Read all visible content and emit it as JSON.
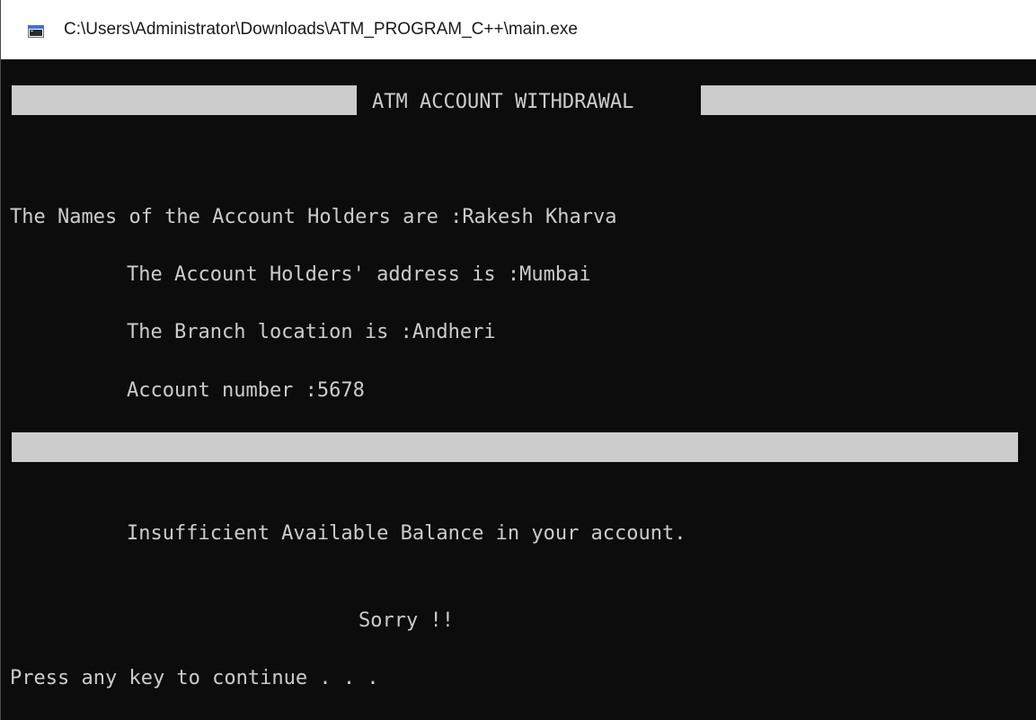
{
  "window": {
    "title": "C:\\Users\\Administrator\\Downloads\\ATM_PROGRAM_C++\\main.exe",
    "icon": "console-window-icon"
  },
  "console": {
    "header": "ATM ACCOUNT WITHDRAWAL",
    "account_holders": "The Names of the Account Holders are :Rakesh Kharva",
    "address": "The Account Holders' address is :Mumbai",
    "branch": "The Branch location is :Andheri",
    "account_number": "Account number :5678",
    "message": "Insufficient Available Balance in your account.",
    "sorry": "Sorry !!",
    "prompt": "Press any key to continue . . ."
  },
  "colors": {
    "background": "#0c0c0c",
    "foreground": "#cccccc"
  }
}
